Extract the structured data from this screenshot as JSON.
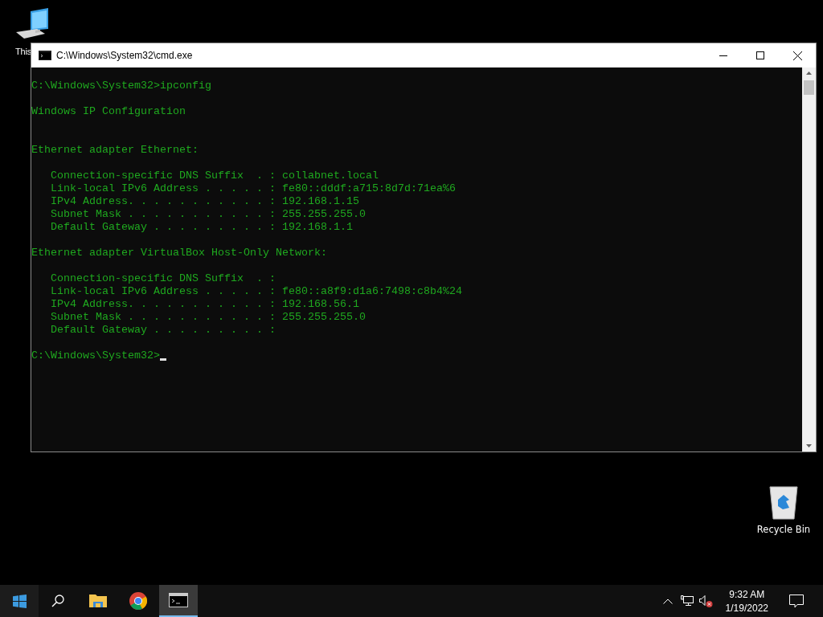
{
  "desktop_icons": [
    {
      "kind": "computer",
      "label": "This"
    },
    {
      "kind": "recycle",
      "label": "Recycle Bin"
    }
  ],
  "window": {
    "title": "C:\\Windows\\System32\\cmd.exe"
  },
  "console": {
    "command_line": "C:\\Windows\\System32>ipconfig",
    "heading": "Windows IP Configuration",
    "adapters": [
      {
        "title": "Ethernet adapter Ethernet:",
        "entries": [
          {
            "label": "Connection-specific DNS Suffix  . :",
            "value": "collabnet.local"
          },
          {
            "label": "Link-local IPv6 Address . . . . . :",
            "value": "fe80::dddf:a715:8d7d:71ea%6"
          },
          {
            "label": "IPv4 Address. . . . . . . . . . . :",
            "value": "192.168.1.15"
          },
          {
            "label": "Subnet Mask . . . . . . . . . . . :",
            "value": "255.255.255.0"
          },
          {
            "label": "Default Gateway . . . . . . . . . :",
            "value": "192.168.1.1"
          }
        ]
      },
      {
        "title": "Ethernet adapter VirtualBox Host-Only Network:",
        "entries": [
          {
            "label": "Connection-specific DNS Suffix  . :"
          },
          {
            "label": "Link-local IPv6 Address . . . . . :",
            "value": "fe80::a8f9:d1a6:7498:c8b4%24"
          },
          {
            "label": "IPv4 Address. . . . . . . . . . . :",
            "value": "192.168.56.1"
          },
          {
            "label": "Subnet Mask . . . . . . . . . . . :",
            "value": "255.255.255.0"
          },
          {
            "label": "Default Gateway . . . . . . . . . :"
          }
        ]
      }
    ],
    "prompt": "C:\\Windows\\System32>"
  },
  "taskbar": {
    "apps": [
      {
        "kind": "folder",
        "selected": false
      },
      {
        "kind": "browser",
        "selected": false
      },
      {
        "kind": "console",
        "selected": true
      }
    ],
    "clock": {
      "time": "9:32 AM",
      "date": "1/19/2022"
    }
  }
}
